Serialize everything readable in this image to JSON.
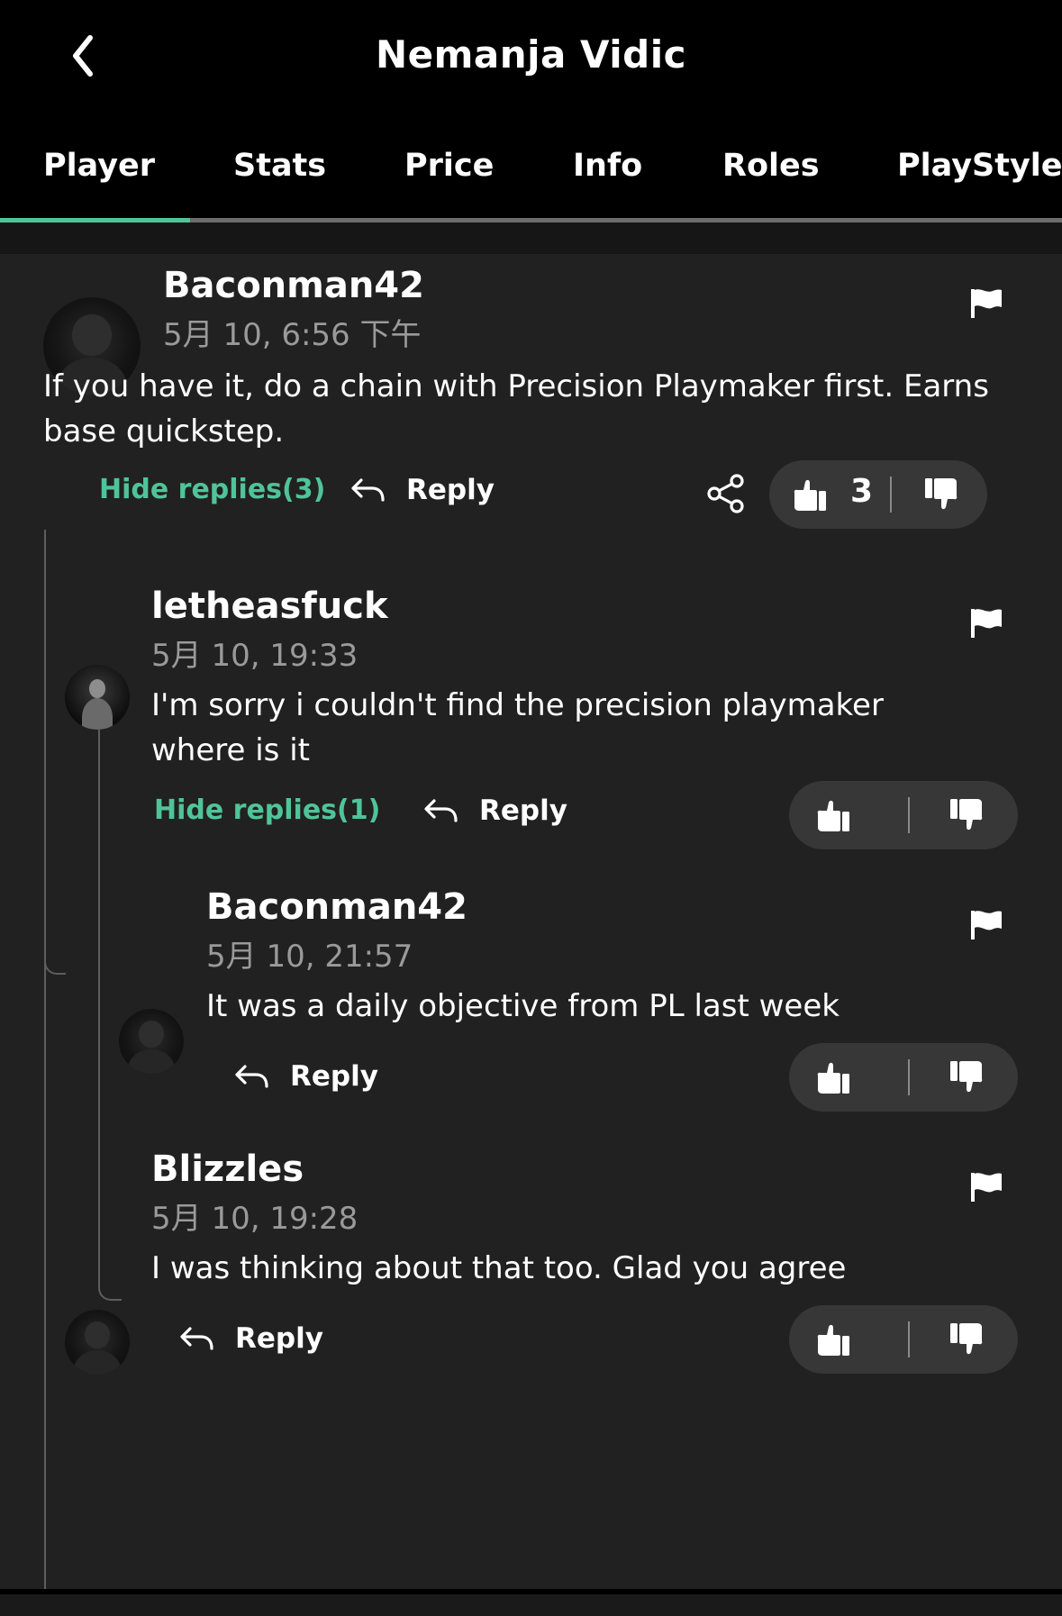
{
  "header": {
    "title": "Nemanja Vidic"
  },
  "tabs": [
    {
      "label": "Player",
      "active": true
    },
    {
      "label": "Stats"
    },
    {
      "label": "Price"
    },
    {
      "label": "Info"
    },
    {
      "label": "Roles"
    },
    {
      "label": "PlayStyles"
    }
  ],
  "colors": {
    "accent": "#4fc49a",
    "panel": "#212121",
    "vote_bg": "#373737",
    "muted": "#9a9a9a"
  },
  "comments": {
    "c1": {
      "username": "Baconman42",
      "timestamp": "5月 10, 6:56 下午",
      "text": "If you have it, do a chain with Precision Playmaker first. Earns base quickstep.",
      "hide_replies": "Hide replies(3)",
      "reply": "Reply",
      "upvotes": "3"
    },
    "c2": {
      "username": "letheasfuck",
      "timestamp": "5月 10, 19:33",
      "text": "I'm sorry i couldn't find the precision playmaker where is it",
      "hide_replies": "Hide replies(1)",
      "reply": "Reply"
    },
    "c3": {
      "username": "Baconman42",
      "timestamp": "5月 10, 21:57",
      "text": "It was a daily objective from PL last week",
      "reply": "Reply"
    },
    "c4": {
      "username": "Blizzles",
      "timestamp": "5月 10, 19:28",
      "text": "I was thinking about that too. Glad you agree",
      "reply": "Reply"
    }
  },
  "icons": [
    "back-icon",
    "flag-icon",
    "reply-arrow-icon",
    "share-icon",
    "thumbs-up-icon",
    "thumbs-down-icon"
  ]
}
